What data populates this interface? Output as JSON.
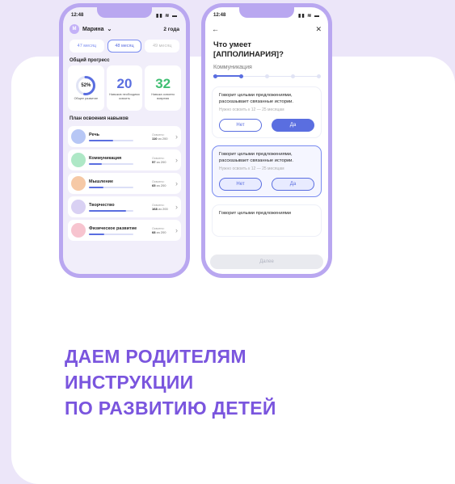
{
  "headline": {
    "line1": "ДАЕМ РОДИТЕЛЯМ",
    "line2": "ИНСТРУКЦИИ",
    "line3": "ПО РАЗВИТИЮ ДЕТЕЙ"
  },
  "phone1": {
    "time": "12:48",
    "status_icons": "▮▮ ≋ ▬",
    "avatar_letter": "М",
    "user_name": "Марина",
    "child_age": "2 года",
    "months": [
      "47 месяц",
      "48 месяц",
      "49 месяц"
    ],
    "selected_month": "48 месяц",
    "progress_title": "Общий прогресс",
    "overall": {
      "percent_label": "52%",
      "percent": 52,
      "caption": "Общее развитие"
    },
    "needed": {
      "number": "20",
      "caption": "Навыков необходимо освоить"
    },
    "mastered": {
      "number": "32",
      "caption": "Навыка освоено вовремя"
    },
    "plan_title": "План освоения навыков",
    "mastered_label": "Освоено:",
    "of_label": "из 200",
    "skills": [
      {
        "name": "Речь",
        "done": "110",
        "progress": 0.55,
        "color": "#b7c7f5"
      },
      {
        "name": "Коммуникация",
        "done": "57",
        "progress": 0.29,
        "color": "#aee8c6"
      },
      {
        "name": "Мышление",
        "done": "65",
        "progress": 0.33,
        "color": "#f6c9a6"
      },
      {
        "name": "Творчество",
        "done": "168",
        "progress": 0.84,
        "color": "#d9d1f3"
      },
      {
        "name": "Физическое развитие",
        "done": "68",
        "progress": 0.34,
        "color": "#f7c4cf"
      }
    ]
  },
  "phone2": {
    "time": "12:48",
    "status_icons": "▮▮ ≋ ▬",
    "back": "←",
    "close": "✕",
    "title_line1": "Что умеет",
    "title_line2": "[АППОЛИНАРИЯ]?",
    "category": "Коммуникация",
    "question_text_line1": "Говорит целыми предложениями,",
    "question_text_line2": "рассказывает связанные истории.",
    "question_sub": "Нужно освоить к 12 — 25 месяцам",
    "no_label": "Нет",
    "yes_label": "Да",
    "partial_text": "Говорит целыми предложениями",
    "next_label": "Далее"
  }
}
